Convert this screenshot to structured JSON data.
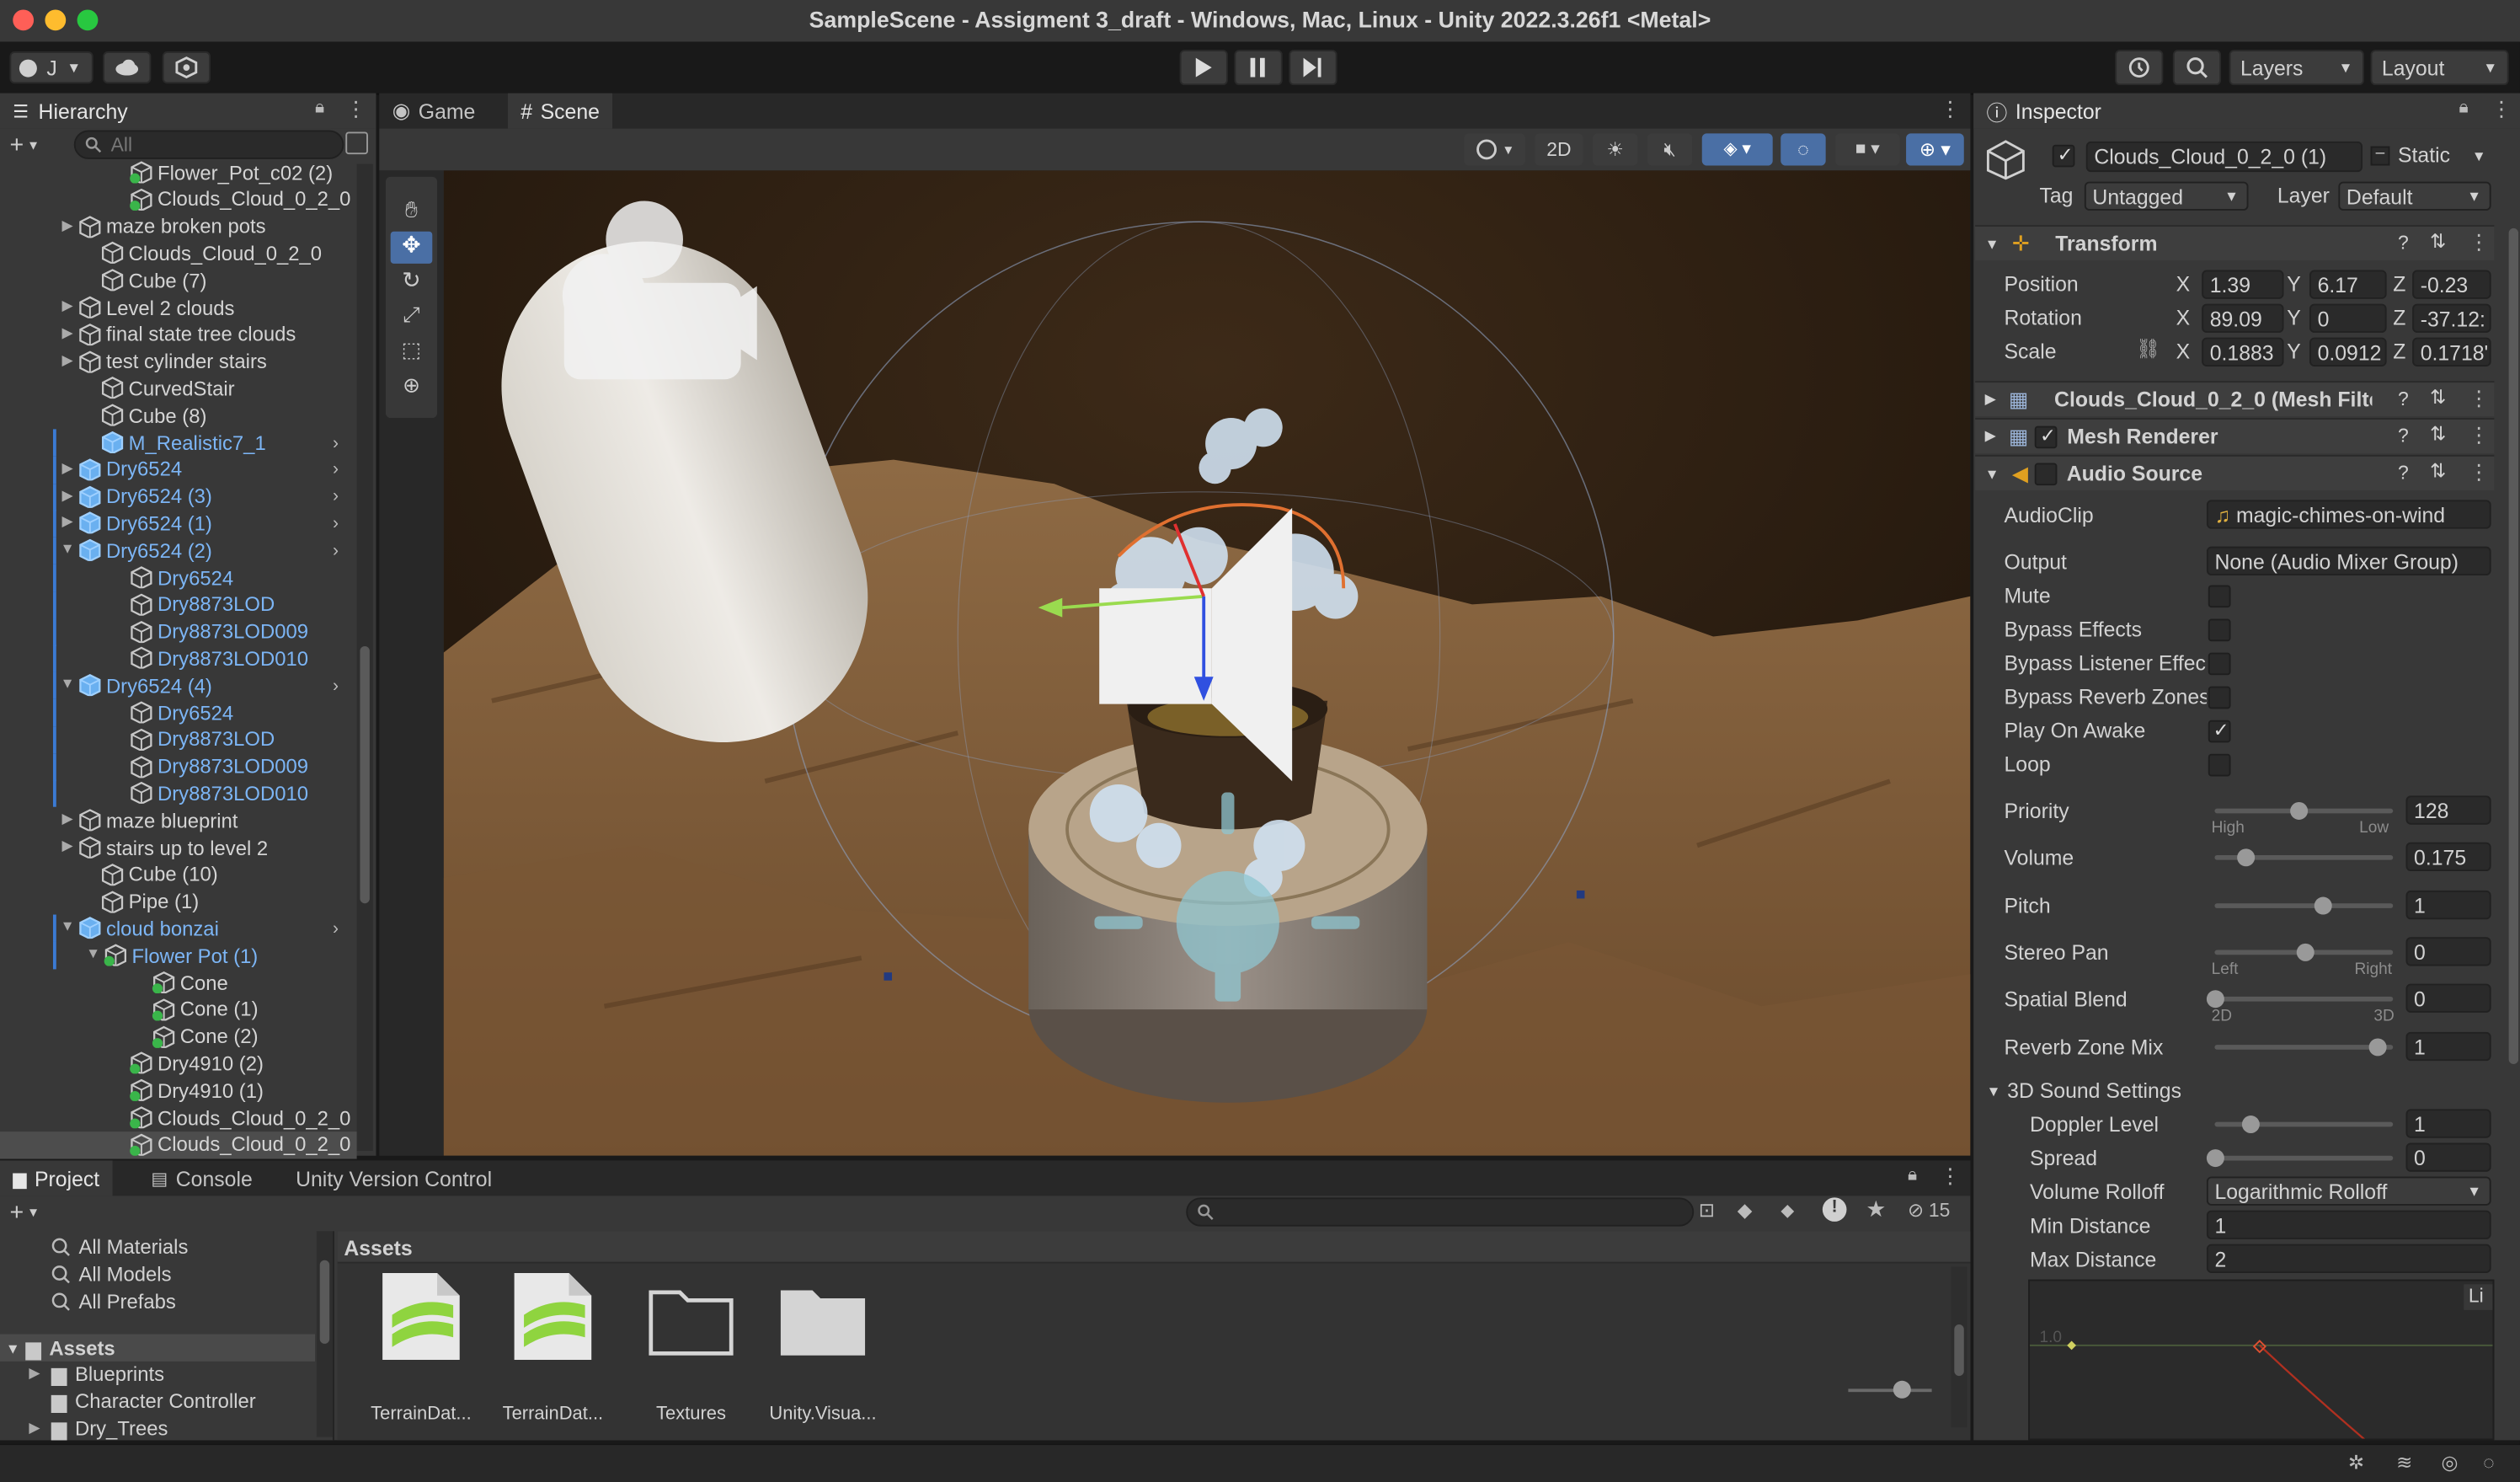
{
  "window": {
    "title": "SampleScene - Assigment 3_draft - Windows, Mac, Linux - Unity 2022.3.26f1 <Metal>"
  },
  "toolbar": {
    "account": "J",
    "layers": "Layers",
    "layout": "Layout"
  },
  "hierarchy": {
    "tab": "Hierarchy",
    "search_placeholder": "All",
    "items": [
      {
        "label": "Flower_Pot_c02 (2)"
      },
      {
        "label": "Clouds_Cloud_0_2_0"
      },
      {
        "label": "maze broken pots"
      },
      {
        "label": "Clouds_Cloud_0_2_0"
      },
      {
        "label": "Cube (7)"
      },
      {
        "label": "Level 2 clouds"
      },
      {
        "label": "final state tree clouds"
      },
      {
        "label": "test cylinder stairs"
      },
      {
        "label": "CurvedStair"
      },
      {
        "label": "Cube (8)"
      },
      {
        "label": "M_Realistic7_1"
      },
      {
        "label": "Dry6524"
      },
      {
        "label": "Dry6524 (3)"
      },
      {
        "label": "Dry6524 (1)"
      },
      {
        "label": "Dry6524 (2)"
      },
      {
        "label": "Dry6524"
      },
      {
        "label": "Dry8873LOD"
      },
      {
        "label": "Dry8873LOD009"
      },
      {
        "label": "Dry8873LOD010"
      },
      {
        "label": "Dry6524 (4)"
      },
      {
        "label": "Dry6524"
      },
      {
        "label": "Dry8873LOD"
      },
      {
        "label": "Dry8873LOD009"
      },
      {
        "label": "Dry8873LOD010"
      },
      {
        "label": "maze blueprint"
      },
      {
        "label": "stairs up to level 2"
      },
      {
        "label": "Cube (10)"
      },
      {
        "label": "Pipe (1)"
      },
      {
        "label": "cloud bonzai"
      },
      {
        "label": "Flower Pot (1)"
      },
      {
        "label": "Cone"
      },
      {
        "label": "Cone (1)"
      },
      {
        "label": "Cone (2)"
      },
      {
        "label": "Dry4910 (2)"
      },
      {
        "label": "Dry4910 (1)"
      },
      {
        "label": "Clouds_Cloud_0_2_0"
      },
      {
        "label": "Clouds_Cloud_0_2_0"
      }
    ]
  },
  "scene": {
    "tab_game": "Game",
    "tab_scene": "Scene",
    "btn_2d": "2D"
  },
  "inspector": {
    "tab": "Inspector",
    "object_name": "Clouds_Cloud_0_2_0 (1)",
    "static_label": "Static",
    "tag_label": "Tag",
    "tag_value": "Untagged",
    "layer_label": "Layer",
    "layer_value": "Default",
    "transform": {
      "title": "Transform",
      "position_label": "Position",
      "rotation_label": "Rotation",
      "scale_label": "Scale",
      "x": "X",
      "y": "Y",
      "z": "Z",
      "position": [
        "1.39",
        "6.17",
        "-0.23"
      ],
      "rotation": [
        "89.09",
        "0",
        "-37.12:"
      ],
      "scale": [
        "0.1883",
        "0.0912",
        "0.1718'"
      ]
    },
    "mesh_filter": "Clouds_Cloud_0_2_0 (Mesh Filte",
    "mesh_renderer": "Mesh Renderer",
    "audio": {
      "title": "Audio Source",
      "audioclip_label": "AudioClip",
      "audioclip_value": "magic-chimes-on-wind",
      "output_label": "Output",
      "output_value": "None (Audio Mixer Group)",
      "mute": "Mute",
      "bypass_effects": "Bypass Effects",
      "bypass_listener": "Bypass Listener Effec",
      "bypass_reverb": "Bypass Reverb Zones",
      "play_on_awake": "Play On Awake",
      "loop": "Loop",
      "priority_label": "Priority",
      "priority_value": "128",
      "priority_low_hint": "High",
      "priority_high_hint": "Low",
      "volume_label": "Volume",
      "volume_value": "0.175",
      "pitch_label": "Pitch",
      "pitch_value": "1",
      "stereo_label": "Stereo Pan",
      "stereo_value": "0",
      "stereo_left": "Left",
      "stereo_right": "Right",
      "spatial_label": "Spatial Blend",
      "spatial_value": "0",
      "spatial_2d": "2D",
      "spatial_3d": "3D",
      "reverb_label": "Reverb Zone Mix",
      "reverb_value": "1",
      "sound3d_title": "3D Sound Settings",
      "doppler_label": "Doppler Level",
      "doppler_value": "1",
      "spread_label": "Spread",
      "spread_value": "0",
      "rolloff_label": "Volume Rolloff",
      "rolloff_value": "Logarithmic Rolloff",
      "min_label": "Min Distance",
      "min_value": "1",
      "max_label": "Max Distance",
      "max_value": "2",
      "graph_tab": "Li",
      "graph_y": "1.0"
    }
  },
  "project": {
    "tab_project": "Project",
    "tab_console": "Console",
    "tab_vc": "Unity Version Control",
    "favorites": [
      "All Materials",
      "All Models",
      "All Prefabs"
    ],
    "assets_root": "Assets",
    "folders": [
      "Blueprints",
      "Character Controller",
      "Dry_Trees"
    ],
    "breadcrumb": "Assets",
    "hidden_count": "15",
    "asset_items": [
      {
        "label": "TerrainDat..."
      },
      {
        "label": "TerrainDat..."
      },
      {
        "label": "Textures"
      },
      {
        "label": "Unity.Visua..."
      }
    ]
  }
}
